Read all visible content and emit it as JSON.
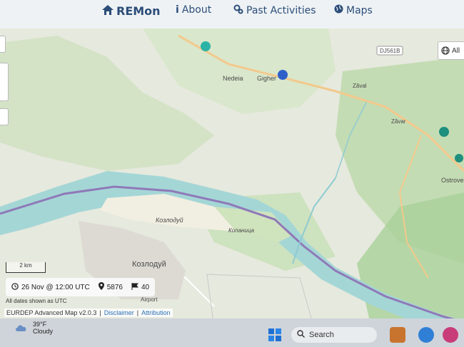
{
  "nav": {
    "brand": "REMon",
    "items": [
      {
        "label": "About",
        "icon": "info-icon"
      },
      {
        "label": "Past Activities",
        "icon": "gears-icon"
      },
      {
        "label": "Maps",
        "icon": "globe-icon"
      }
    ]
  },
  "map": {
    "layer_button": "All",
    "road_badge": "DJ561B",
    "place_labels": {
      "nedeia": "Nedeia",
      "gigher": "Gigher",
      "zaval": "Zăval",
      "zavar": "Zăvar",
      "ostrove": "Ostrove",
      "kozloduy_island": "Козлодуй",
      "kopanica": "Копаница",
      "kozloduy_town": "Козлодуй",
      "airport": "Airport"
    },
    "scale_label": "2 km",
    "marker_colors": {
      "teal": "#2bb3a6",
      "blue": "#2f5fc9",
      "dark_teal": "#1f8f7e"
    }
  },
  "info": {
    "datetime": "26 Nov @ 12:00 UTC",
    "count": "5876",
    "flag_count": "40",
    "note": "All dates shown as UTC"
  },
  "footer": {
    "version": "EURDEP Advanced Map v2.0.3",
    "disclaimer": "Disclaimer",
    "attribution": "Attribution"
  },
  "taskbar": {
    "temp": "39°F",
    "condition": "Cloudy",
    "search": "Search"
  }
}
